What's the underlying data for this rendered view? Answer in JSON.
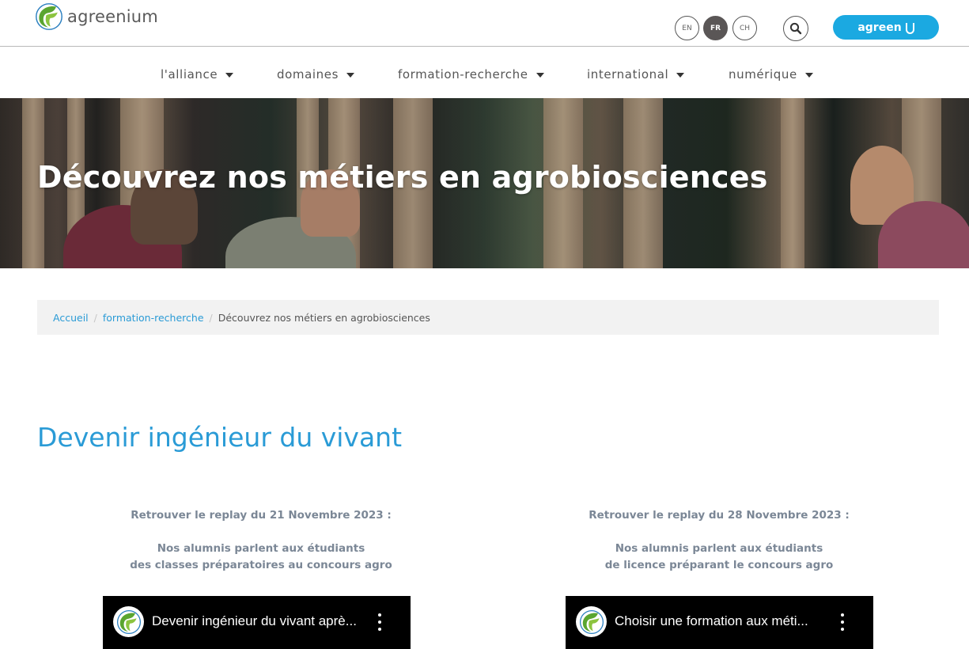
{
  "header": {
    "logo_text": "agreenium",
    "languages": [
      {
        "code": "EN",
        "active": false
      },
      {
        "code": "FR",
        "active": true
      },
      {
        "code": "CH",
        "active": false
      }
    ],
    "search_icon": "search-icon",
    "agreenu_label": "agreen"
  },
  "nav": {
    "items": [
      {
        "label": "l'alliance"
      },
      {
        "label": "domaines"
      },
      {
        "label": "formation-recherche"
      },
      {
        "label": "international"
      },
      {
        "label": "numérique"
      }
    ]
  },
  "hero": {
    "title": "Découvrez nos métiers en agrobiosciences"
  },
  "breadcrumb": {
    "items": [
      {
        "label": "Accueil"
      },
      {
        "label": "formation-recherche"
      }
    ],
    "separator": "/",
    "current": "Découvrez nos métiers en agrobiosciences"
  },
  "section": {
    "title": "Devenir ingénieur du vivant",
    "columns": [
      {
        "replay": "Retrouver le replay du 21 Novembre 2023 :",
        "desc_line1": "Nos alumnis parlent aux étudiants",
        "desc_line2": "des classes préparatoires au concours agro",
        "video_title": "Devenir ingénieur du vivant aprè..."
      },
      {
        "replay": "Retrouver le replay du 28 Novembre 2023 :",
        "desc_line1": "Nos alumnis parlent aux étudiants",
        "desc_line2": "de licence préparant le concours agro",
        "video_title": "Choisir une formation aux méti..."
      }
    ]
  },
  "colors": {
    "accent_blue": "#1ba9e1",
    "link_blue": "#2a9bd6",
    "active_lang": "#5a5656",
    "subtitle_gray": "#7b8796"
  }
}
